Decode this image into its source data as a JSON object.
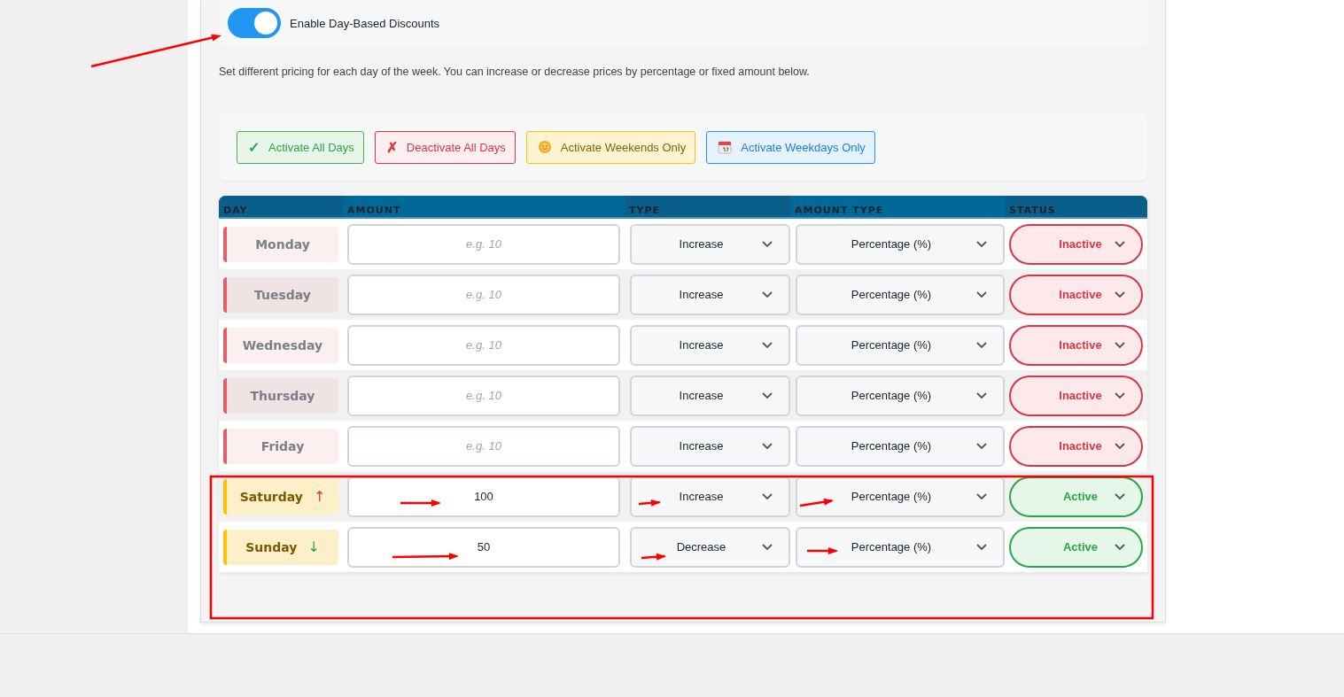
{
  "toggle": {
    "label": "Enable Day-Based Discounts",
    "on": true
  },
  "description": "Set different pricing for each day of the week. You can increase or decrease prices by percentage or fixed amount below.",
  "quick_actions": [
    {
      "kind": "check",
      "icon": "✓",
      "label": "Activate All Days"
    },
    {
      "kind": "cross",
      "icon": "✗",
      "label": "Deactivate All Days"
    },
    {
      "kind": "weekend",
      "label": "Activate Weekends Only"
    },
    {
      "kind": "weekday",
      "label": "Activate Weekdays Only"
    }
  ],
  "table": {
    "columns": [
      "DAY",
      "AMOUNT",
      "TYPE",
      "AMOUNT TYPE",
      "STATUS"
    ],
    "rows": [
      {
        "day": "Monday",
        "active": false,
        "placeholder": "e.g. 10",
        "type": "Increase",
        "amount_type": "Percentage (%)",
        "status": "Inactive"
      },
      {
        "day": "Tuesday",
        "active": false,
        "placeholder": "e.g. 10",
        "type": "Increase",
        "amount_type": "Percentage (%)",
        "status": "Inactive"
      },
      {
        "day": "Wednesday",
        "active": false,
        "placeholder": "e.g. 10",
        "type": "Increase",
        "amount_type": "Percentage (%)",
        "status": "Inactive"
      },
      {
        "day": "Thursday",
        "active": false,
        "placeholder": "e.g. 10",
        "type": "Increase",
        "amount_type": "Percentage (%)",
        "status": "Inactive"
      },
      {
        "day": "Friday",
        "active": false,
        "placeholder": "e.g. 10",
        "type": "Increase",
        "amount_type": "Percentage (%)",
        "status": "Inactive"
      },
      {
        "day": "Saturday",
        "trend": "↑",
        "kind": "up",
        "active": true,
        "value": "100",
        "type": "Increase",
        "amount_type": "Percentage (%)",
        "status": "Active"
      },
      {
        "day": "Sunday",
        "trend": "↓",
        "kind": "down",
        "active": true,
        "value": "50",
        "type": "Decrease",
        "amount_type": "Percentage (%)",
        "status": "Active"
      }
    ]
  }
}
